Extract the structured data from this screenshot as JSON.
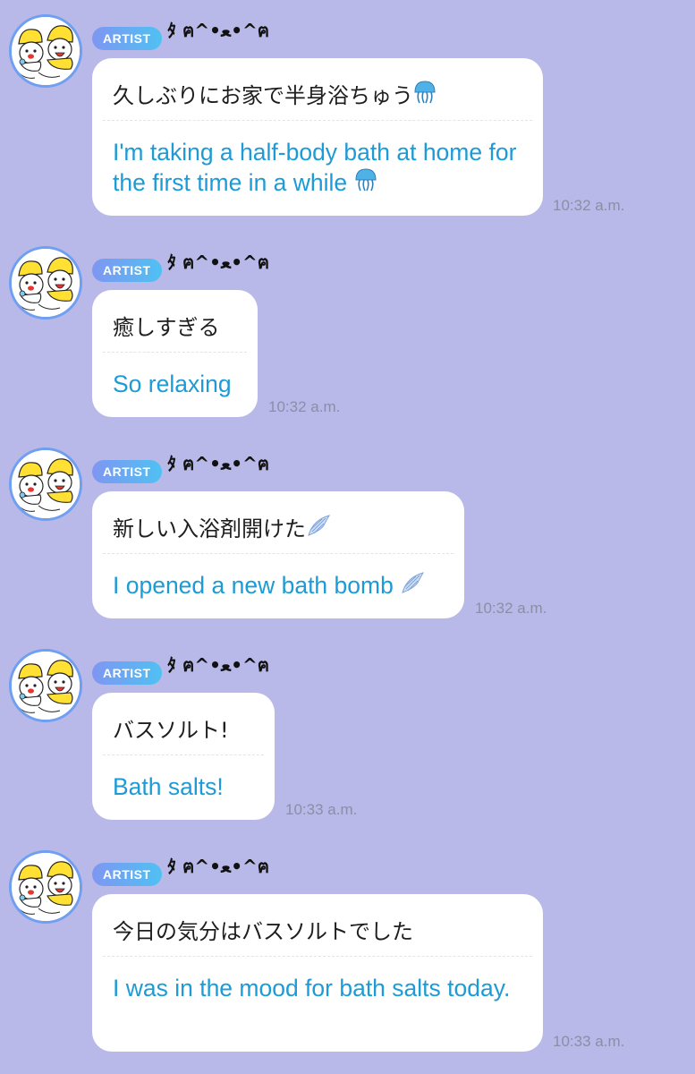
{
  "messages": [
    {
      "badge": "ARTIST",
      "sender": "ﾀ ฅ^•ﻌ•^ฅ",
      "japanese": "久しぶりにお家で半身浴ちゅう",
      "english": "I'm taking a half-body bath at home for the first time in a while",
      "emoji": "jellyfish",
      "time": "10:32 a.m."
    },
    {
      "badge": "ARTIST",
      "sender": "ﾀ ฅ^•ﻌ•^ฅ",
      "japanese": "癒しすぎる",
      "english": "So relaxing",
      "time": "10:32 a.m."
    },
    {
      "badge": "ARTIST",
      "sender": "ﾀ ฅ^•ﻌ•^ฅ",
      "japanese": "新しい入浴剤開けた",
      "english": "I opened a new bath bomb",
      "emoji": "wing",
      "time": "10:32 a.m."
    },
    {
      "badge": "ARTIST",
      "sender": "ﾀ ฅ^•ﻌ•^ฅ",
      "japanese": "バスソルト!",
      "english": "Bath salts!",
      "time": "10:33 a.m."
    },
    {
      "badge": "ARTIST",
      "sender": "ﾀ ฅ^•ﻌ•^ฅ",
      "japanese": "今日の気分はバスソルトでした",
      "english": "I was in the mood for bath salts today.",
      "time": "10:33 a.m."
    }
  ],
  "colors": {
    "background": "#b8b9e8",
    "badge_gradient_start": "#7f96f2",
    "badge_gradient_end": "#4fc1f2",
    "translation_text": "#1c9bd6",
    "timestamp": "#8b8ea6"
  }
}
